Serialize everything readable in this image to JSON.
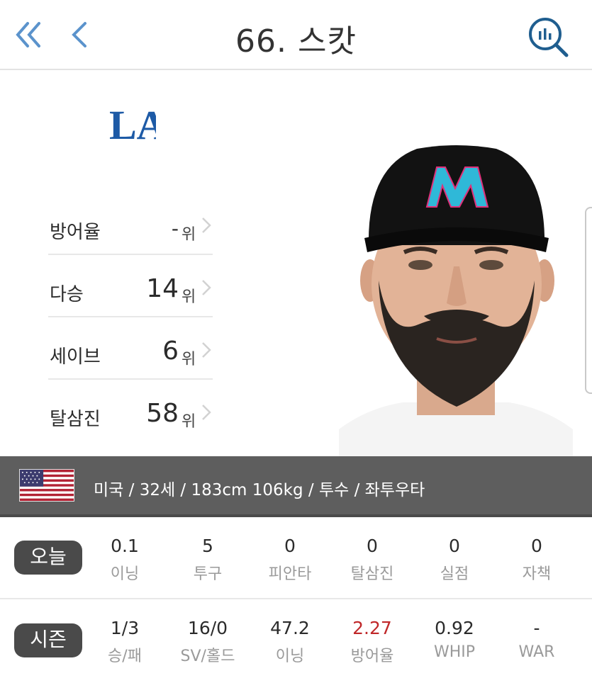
{
  "header": {
    "title": "66. 스캇"
  },
  "team": {
    "logo_text": "LA",
    "logo_color": "#1d5aa6"
  },
  "ranks": [
    {
      "label": "방어율",
      "value": "-",
      "unit": "위"
    },
    {
      "label": "다승",
      "value": "14",
      "unit": "위"
    },
    {
      "label": "세이브",
      "value": "6",
      "unit": "위"
    },
    {
      "label": "탈삼진",
      "value": "58",
      "unit": "위"
    }
  ],
  "player_info": {
    "flag": "us-flag",
    "text": "미국 / 32세 / 183cm 106kg / 투수 / 좌투우타"
  },
  "today": {
    "label": "오늘",
    "stats": [
      {
        "value": "0.1",
        "label": "이닝"
      },
      {
        "value": "5",
        "label": "투구"
      },
      {
        "value": "0",
        "label": "피안타"
      },
      {
        "value": "0",
        "label": "탈삼진"
      },
      {
        "value": "0",
        "label": "실점"
      },
      {
        "value": "0",
        "label": "자책"
      }
    ]
  },
  "season": {
    "label": "시즌",
    "stats": [
      {
        "value": "1/3",
        "label": "승/패"
      },
      {
        "value": "16/0",
        "label": "SV/홀드"
      },
      {
        "value": "47.2",
        "label": "이닝"
      },
      {
        "value": "2.27",
        "label": "방어율",
        "highlight": "#c0282a"
      },
      {
        "value": "0.92",
        "label": "WHIP"
      },
      {
        "value": "-",
        "label": "WAR"
      }
    ]
  },
  "colors": {
    "accent_blue": "#4a86c5",
    "info_bar": "#5e5e5e",
    "pill": "#4a4a4a",
    "era_red": "#c0282a"
  }
}
